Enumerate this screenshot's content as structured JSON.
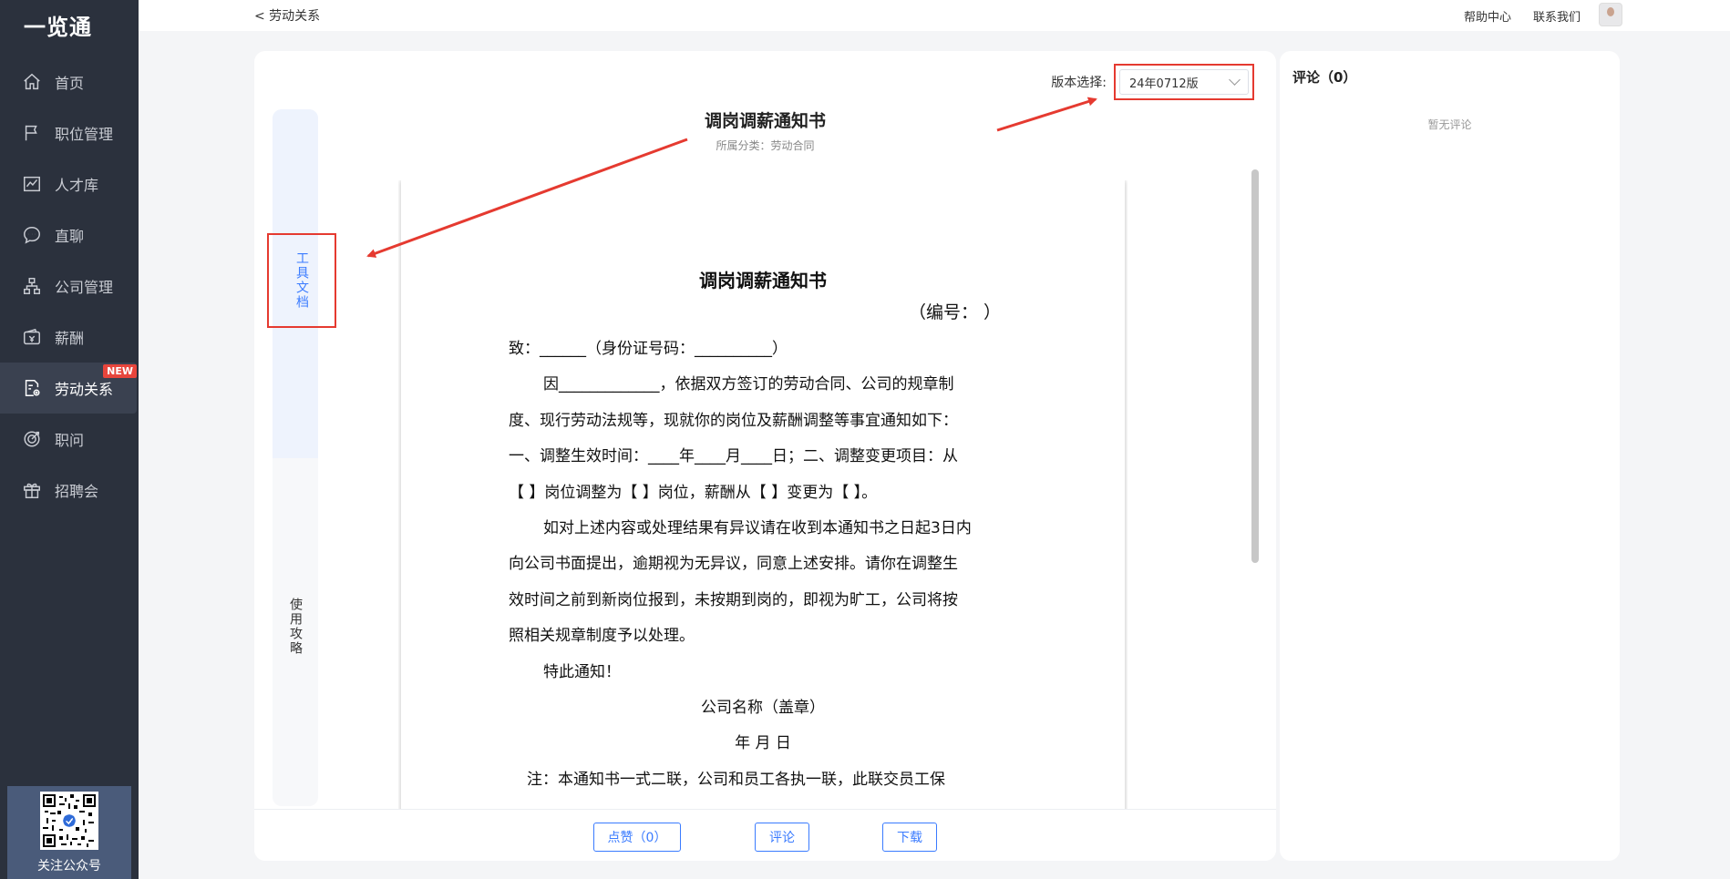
{
  "sidebar": {
    "logo": "一览通",
    "items": [
      {
        "label": "首页",
        "icon": "home-icon"
      },
      {
        "label": "职位管理",
        "icon": "flag-icon"
      },
      {
        "label": "人才库",
        "icon": "chart-line-icon"
      },
      {
        "label": "直聊",
        "icon": "chat-bubble-icon"
      },
      {
        "label": "公司管理",
        "icon": "org-chart-icon"
      },
      {
        "label": "薪酬",
        "icon": "wallet-icon"
      },
      {
        "label": "劳动关系",
        "icon": "document-gear-icon",
        "active": true,
        "badge": "NEW"
      },
      {
        "label": "职问",
        "icon": "target-icon"
      },
      {
        "label": "招聘会",
        "icon": "gift-icon"
      }
    ],
    "qr_label": "关注公众号"
  },
  "topbar": {
    "back_label": "< 劳动关系",
    "help": "帮助中心",
    "contact": "联系我们"
  },
  "document": {
    "version_label": "版本选择:",
    "version_value": "24年0712版",
    "title": "调岗调薪通知书",
    "category": "所属分类：劳动合同",
    "side_tab_tool": "工具文档",
    "side_tab_guide": "使用攻略",
    "paper": {
      "title": "调岗调薪通知书",
      "number": "（编号：          ）",
      "lines": [
        {
          "text": "致：______（身份证号码：__________）",
          "style": "plain"
        },
        {
          "text": "因_____________，依据双方签订的劳动合同、公司的规章制",
          "style": "indent"
        },
        {
          "text": "度、现行劳动法规等，现就你的岗位及薪酬调整等事宜通知如下：",
          "style": "plain"
        },
        {
          "text": "一、调整生效时间：____年____月____日；二、调整变更项目：从",
          "style": "plain"
        },
        {
          "text": "【     】岗位调整为【     】岗位，薪酬从【     】变更为【     】。",
          "style": "plain"
        },
        {
          "text": "如对上述内容或处理结果有异议请在收到本通知书之日起3日内",
          "style": "indent"
        },
        {
          "text": "向公司书面提出，逾期视为无异议，同意上述安排。请你在调整生",
          "style": "plain"
        },
        {
          "text": "效时间之前到新岗位报到，未按期到岗的，即视为旷工，公司将按",
          "style": "plain"
        },
        {
          "text": "照相关规章制度予以处理。",
          "style": "plain"
        },
        {
          "text": "特此通知！",
          "style": "indent"
        },
        {
          "text": "公司名称（盖章）",
          "style": "center"
        },
        {
          "text": "年   月   日",
          "style": "center"
        },
        {
          "text": "注：本通知书一式二联，公司和员工各执一联，此联交员工保",
          "style": "note"
        }
      ]
    },
    "actions": {
      "like": "点赞（0）",
      "comment": "评论",
      "download": "下载"
    }
  },
  "comments": {
    "title": "评论（0）",
    "empty": "暂无评论"
  },
  "colors": {
    "sidebar_bg": "#2b313d",
    "accent": "#3a7bff",
    "highlight_red": "#e53a30"
  }
}
